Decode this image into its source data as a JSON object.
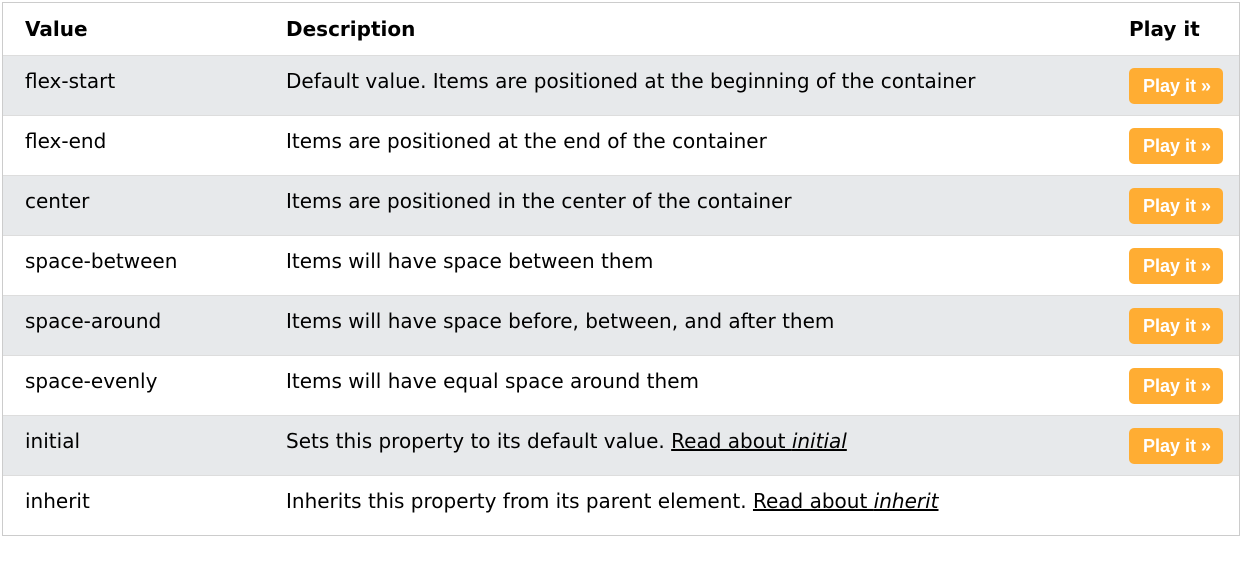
{
  "headers": {
    "value": "Value",
    "description": "Description",
    "play": "Play it"
  },
  "rows": [
    {
      "value": "flex-start",
      "description": "Default value. Items are positioned at the beginning of the container",
      "play": "Play it »"
    },
    {
      "value": "flex-end",
      "description": "Items are positioned at the end of the container",
      "play": "Play it »"
    },
    {
      "value": "center",
      "description": "Items are positioned in the center of the container",
      "play": "Play it »"
    },
    {
      "value": "space-between",
      "description": "Items will have space between them",
      "play": "Play it »"
    },
    {
      "value": "space-around",
      "description": "Items will have space before, between, and after them",
      "play": "Play it »"
    },
    {
      "value": "space-evenly",
      "description": "Items will have equal space around them",
      "play": "Play it »"
    },
    {
      "value": "initial",
      "description": "Sets this property to its default value.",
      "link_prefix": "Read about ",
      "link_term": "initial",
      "play": "Play it »"
    },
    {
      "value": "inherit",
      "description": "Inherits this property from its parent element.",
      "link_prefix": "Read about ",
      "link_term": "inherit"
    }
  ],
  "colors": {
    "play_button_bg": "#ffad33",
    "play_button_text": "#ffffff",
    "row_stripe": "#e7e9eb"
  }
}
